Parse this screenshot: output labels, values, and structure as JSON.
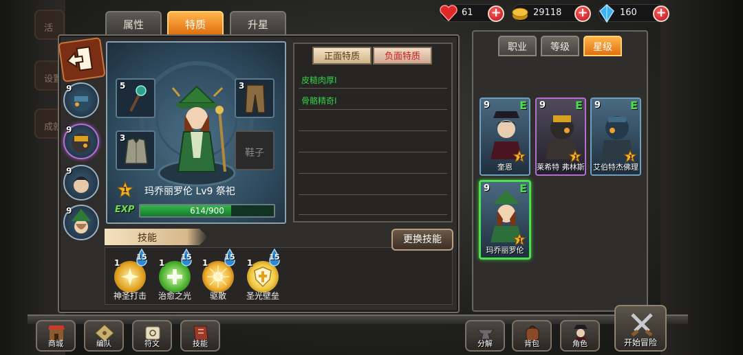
{
  "resources": [
    {
      "icon": "heart-icon",
      "value": "61"
    },
    {
      "icon": "gold-coin-icon",
      "value": "29118"
    },
    {
      "icon": "crystal-icon",
      "value": "160"
    }
  ],
  "side_menu_ghost": [
    "活",
    "设置",
    "成就"
  ],
  "main_tabs": [
    "属性",
    "特质",
    "升星"
  ],
  "active_main_tab": "特质",
  "side_heroes": [
    {
      "level": "9",
      "icon": "hero-armored-blue-icon"
    },
    {
      "level": "9",
      "icon": "hero-armored-gold-icon"
    },
    {
      "level": "9",
      "icon": "hero-dark-hair-icon"
    },
    {
      "level": "9",
      "icon": "hero-green-hat-icon"
    }
  ],
  "hero": {
    "star": "1",
    "name_line": "玛乔丽罗伦  Lv9  祭祀",
    "exp_label": "EXP",
    "exp_text": "614/900",
    "exp_progress": 0.682,
    "equipment": [
      {
        "level": "5",
        "icon": "staff-icon"
      },
      {
        "level": "3",
        "icon": "pants-icon"
      },
      {
        "level": "3",
        "icon": "vest-icon"
      },
      {
        "level": "",
        "label": "鞋子"
      }
    ]
  },
  "traits": {
    "tabs": [
      "正面特质",
      "负面特质"
    ],
    "active": "负面特质",
    "items": [
      "皮糙肉厚I",
      "骨骼精奇I"
    ]
  },
  "skills": {
    "header": "技能",
    "swap_button": "更换技能",
    "items": [
      {
        "level": "1",
        "cost": "15",
        "name": "神圣打击",
        "icon": "holy-strike-icon"
      },
      {
        "level": "1",
        "cost": "15",
        "name": "治愈之光",
        "icon": "healing-light-icon"
      },
      {
        "level": "1",
        "cost": "15",
        "name": "驱散",
        "icon": "dispel-icon"
      },
      {
        "level": "1",
        "cost": "15",
        "name": "圣光壁垒",
        "icon": "holy-barrier-icon"
      }
    ]
  },
  "right_tabs": [
    "职业",
    "等级",
    "星级"
  ],
  "active_right_tab": "星级",
  "team_cards": [
    {
      "level": "9",
      "grade": "E",
      "star": "1",
      "name": "奎恩",
      "border": "#6fa0c0"
    },
    {
      "level": "9",
      "grade": "E",
      "star": "1",
      "name": "莱希特 弗林斯",
      "border": "#b56fd0"
    },
    {
      "level": "9",
      "grade": "E",
      "star": "1",
      "name": "艾伯特杰佛理",
      "border": "#6fa0c0"
    },
    {
      "level": "9",
      "grade": "E",
      "star": "1",
      "name": "玛乔丽罗伦",
      "border": "#4ee04e"
    }
  ],
  "bottom_nav": [
    "商城",
    "编队",
    "符文",
    "技能",
    "分解",
    "背包",
    "角色"
  ],
  "adventure_button": "开始冒险"
}
